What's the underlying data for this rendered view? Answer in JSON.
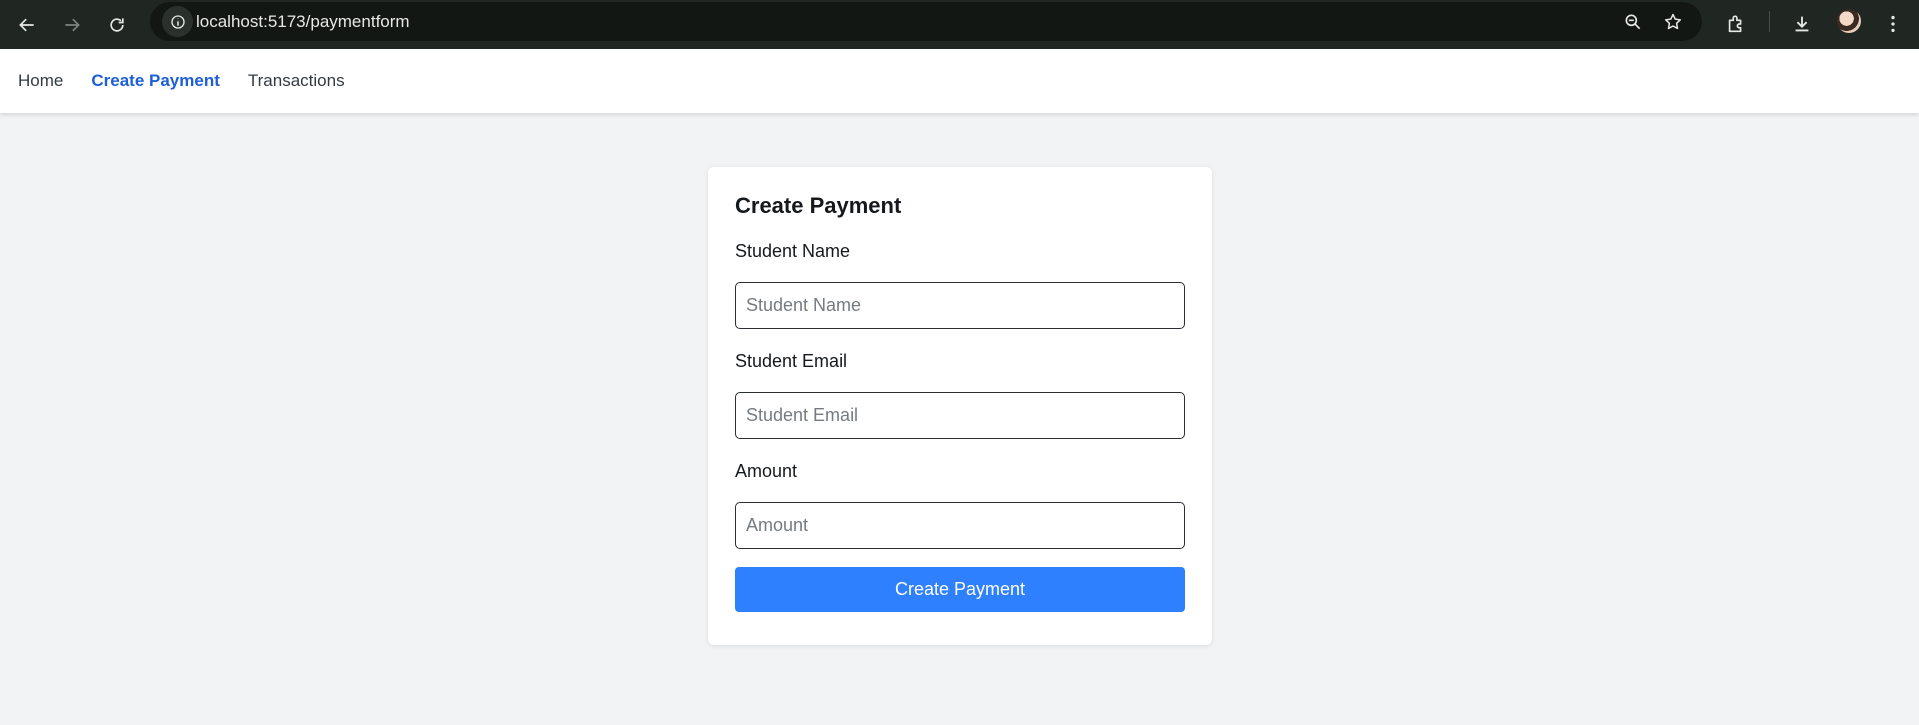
{
  "browser": {
    "url": "localhost:5173/paymentform",
    "icons": [
      "back-arrow-icon",
      "forward-arrow-icon",
      "reload-icon",
      "site-info-icon",
      "zoom-icon",
      "bookmark-star-icon",
      "extensions-icon",
      "download-icon",
      "profile-avatar",
      "menu-kebab-icon"
    ]
  },
  "nav": {
    "items": [
      {
        "label": "Home",
        "active": false
      },
      {
        "label": "Create Payment",
        "active": true
      },
      {
        "label": "Transactions",
        "active": false
      }
    ],
    "active_color": "#1d5fd6"
  },
  "form": {
    "title": "Create Payment",
    "fields": [
      {
        "label": "Student Name",
        "placeholder": "Student Name",
        "value": ""
      },
      {
        "label": "Student Email",
        "placeholder": "Student Email",
        "value": ""
      },
      {
        "label": "Amount",
        "placeholder": "Amount",
        "value": ""
      }
    ],
    "submit_label": "Create Payment",
    "accent_color": "#2e80ff"
  }
}
